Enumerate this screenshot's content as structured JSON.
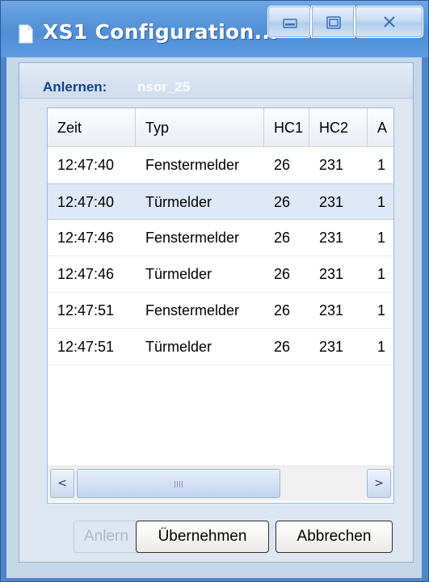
{
  "window": {
    "title": "XS1 Configuration...",
    "controls": {
      "minimize_icon": "minimize-icon",
      "maximize_icon": "maximize-icon",
      "close_icon": "close-icon"
    }
  },
  "group": {
    "title": "Anlernen:",
    "ghost_text": "nsor_25"
  },
  "grid": {
    "columns": [
      "Zeit",
      "Typ",
      "HC1",
      "HC2",
      "A"
    ],
    "rows": [
      {
        "zeit": "12:47:40",
        "typ": "Fenstermelder",
        "hc1": "26",
        "hc2": "231",
        "extra": "1"
      },
      {
        "zeit": "12:47:40",
        "typ": "Türmelder",
        "hc1": "26",
        "hc2": "231",
        "extra": "1",
        "selected": true
      },
      {
        "zeit": "12:47:46",
        "typ": "Fenstermelder",
        "hc1": "26",
        "hc2": "231",
        "extra": "1"
      },
      {
        "zeit": "12:47:46",
        "typ": "Türmelder",
        "hc1": "26",
        "hc2": "231",
        "extra": "1"
      },
      {
        "zeit": "12:47:51",
        "typ": "Fenstermelder",
        "hc1": "26",
        "hc2": "231",
        "extra": "1"
      },
      {
        "zeit": "12:47:51",
        "typ": "Türmelder",
        "hc1": "26",
        "hc2": "231",
        "extra": "1"
      }
    ],
    "scrollbar": {
      "left_arrow": "<",
      "right_arrow": ">"
    }
  },
  "buttons": {
    "ghost_label": "Anlern",
    "apply_label": "Übernehmen",
    "cancel_label": "Abbrechen"
  },
  "colors": {
    "titlebar": "#5c99dc",
    "group_title": "#15428b",
    "selected_row": "#dfe8f6"
  }
}
